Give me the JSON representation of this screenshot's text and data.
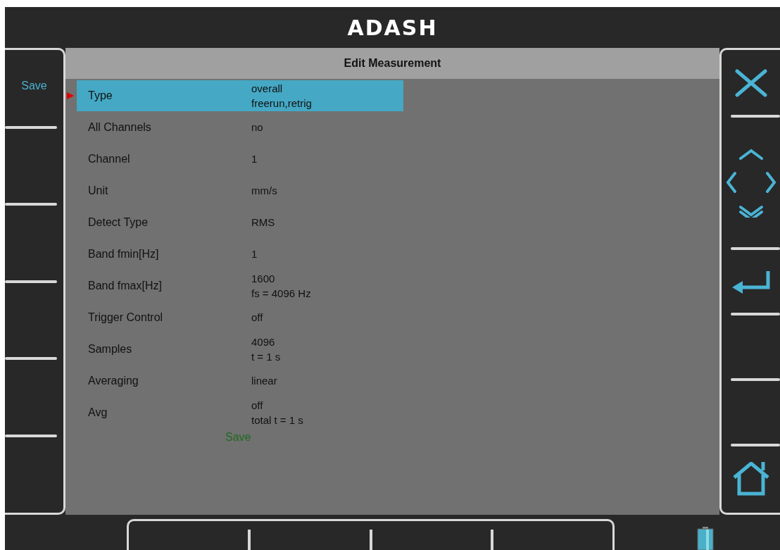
{
  "title": "ADASH",
  "left_softkeys": [
    {
      "label": "Save"
    }
  ],
  "right_softkeys": [
    {
      "kind": "close"
    },
    {
      "kind": "navigate"
    },
    {
      "kind": "enter"
    },
    {
      "kind": "empty"
    },
    {
      "kind": "empty"
    },
    {
      "kind": "home"
    }
  ],
  "form": {
    "title": "Edit Measurement",
    "rows": [
      {
        "label": "Type",
        "value": [
          "overall",
          "freerun,retrig"
        ],
        "selected": true
      },
      {
        "label": "All Channels",
        "value": [
          "no"
        ],
        "selected": false
      },
      {
        "label": "Channel",
        "value": [
          "1"
        ],
        "selected": false
      },
      {
        "label": "Unit",
        "value": [
          "mm/s"
        ],
        "selected": false
      },
      {
        "label": "Detect Type",
        "value": [
          "RMS"
        ],
        "selected": false
      },
      {
        "label": "Band fmin[Hz]",
        "value": [
          "1"
        ],
        "selected": false
      },
      {
        "label": "Band fmax[Hz]",
        "value": [
          "1600",
          "fs = 4096 Hz"
        ],
        "selected": false
      },
      {
        "label": "Trigger Control",
        "value": [
          "off"
        ],
        "selected": false
      },
      {
        "label": "Samples",
        "value": [
          "4096",
          "t = 1 s"
        ],
        "selected": false
      },
      {
        "label": "Averaging",
        "value": [
          "linear"
        ],
        "selected": false
      },
      {
        "label": "Avg",
        "value": [
          "off",
          "total t = 1 s"
        ],
        "selected": false
      }
    ],
    "save_label": "Save"
  }
}
